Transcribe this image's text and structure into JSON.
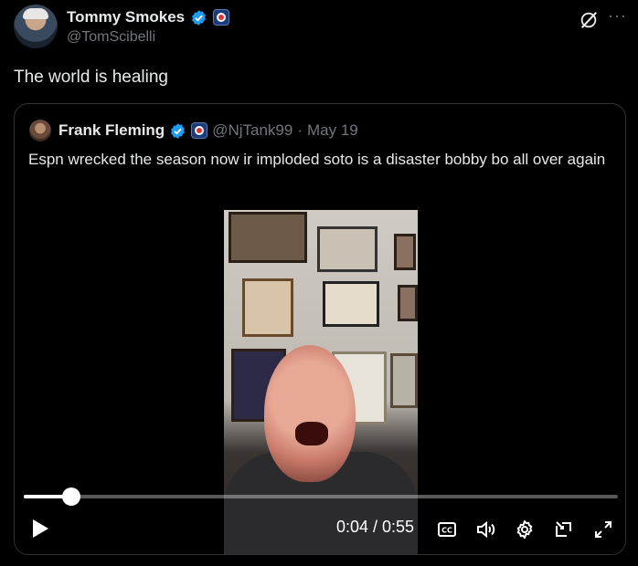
{
  "author": {
    "name": "Tommy Smokes",
    "handle": "@TomScibelli"
  },
  "tweet": {
    "text": "The world is healing"
  },
  "quoted": {
    "name": "Frank Fleming",
    "handle": "@NjTank99",
    "separator": "·",
    "date": "May 19",
    "text": "Espn wrecked the season now ir imploded soto is a disaster bobby bo all over again"
  },
  "video": {
    "current_time": "0:04",
    "duration": "0:55",
    "time_display": "0:04 / 0:55",
    "progress": 0.08
  },
  "icons": {
    "verified": "verified-badge-icon",
    "affiliate": "affiliate-badge-icon",
    "grok": "grok-icon",
    "more": "more-options-icon",
    "play": "play-icon",
    "captions": "captions-icon",
    "volume": "volume-icon",
    "settings": "settings-gear-icon",
    "dock": "dock-video-icon",
    "fullscreen": "fullscreen-icon"
  },
  "colors": {
    "background": "#000000",
    "text": "#e7e9ea",
    "muted": "#71767b",
    "verified_blue": "#1d9bf0",
    "border": "#2f3336"
  }
}
